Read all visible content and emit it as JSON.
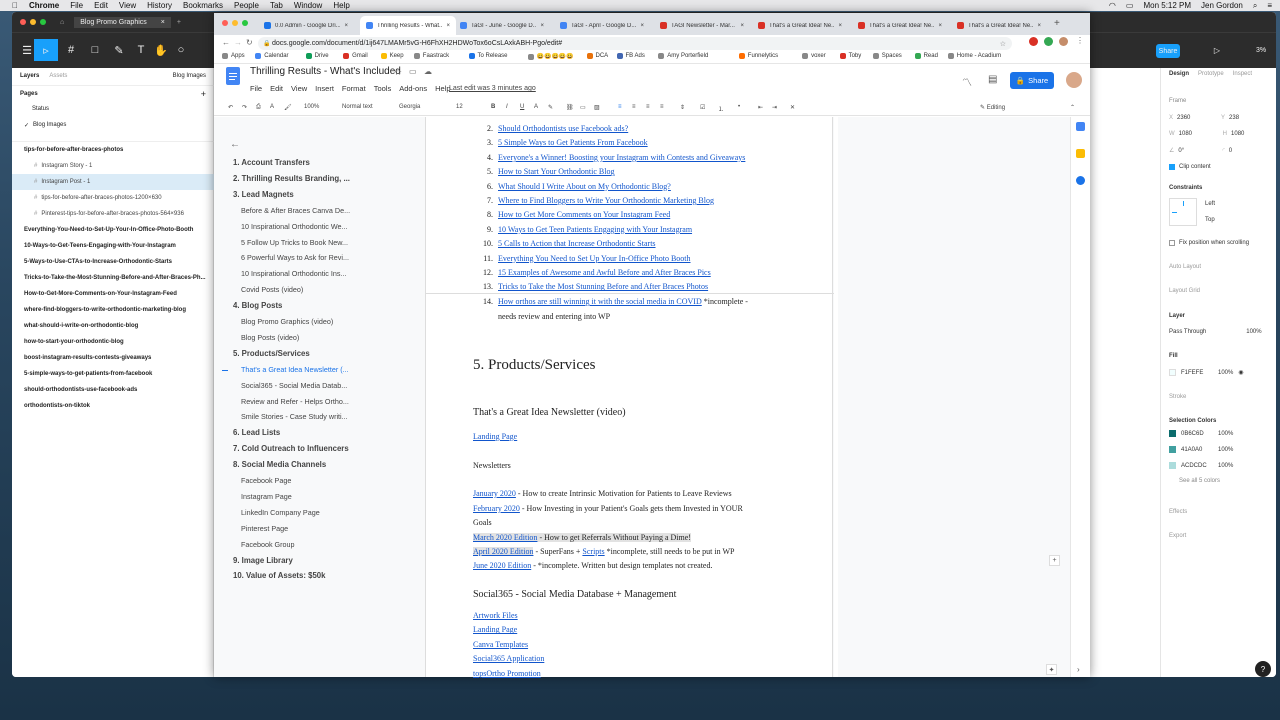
{
  "menubar": {
    "app": "Chrome",
    "items": [
      "File",
      "Edit",
      "View",
      "History",
      "Bookmarks",
      "People",
      "Tab",
      "Window",
      "Help"
    ],
    "clock": "Mon 5:12 PM",
    "user": "Jen Gordon"
  },
  "figma": {
    "file_tab": "Blog Promo Graphics",
    "left_tabs": {
      "layers": "Layers",
      "assets": "Assets",
      "page_select": "Blog Images"
    },
    "pages_title": "Pages",
    "pages": [
      "Status",
      "Blog Images"
    ],
    "layers": [
      {
        "label": "tips-for-before-after-braces-photos",
        "indent": 0,
        "bold": true
      },
      {
        "label": "Instagram Story - 1",
        "indent": 1,
        "bold": false
      },
      {
        "label": "Instagram Post - 1",
        "indent": 1,
        "bold": false,
        "selected": true
      },
      {
        "label": "tips-for-before-after-braces-photos-1200×630",
        "indent": 1,
        "bold": false
      },
      {
        "label": "Pinterest-tips-for-before-after-braces-photos-564×936",
        "indent": 1,
        "bold": false
      },
      {
        "label": "Everything-You-Need-to-Set-Up-Your-In-Office-Photo-Booth",
        "indent": 0,
        "bold": true
      },
      {
        "label": "10-Ways-to-Get-Teens-Engaging-with-Your-Instagram",
        "indent": 0,
        "bold": true
      },
      {
        "label": "5-Ways-to-Use-CTAs-to-Increase-Orthodontic-Starts",
        "indent": 0,
        "bold": true
      },
      {
        "label": "Tricks-to-Take-the-Most-Stunning-Before-and-After-Braces-Ph...",
        "indent": 0,
        "bold": true
      },
      {
        "label": "How-to-Get-More-Comments-on-Your-Instagram-Feed",
        "indent": 0,
        "bold": true
      },
      {
        "label": "where-find-bloggers-to-write-orthodontic-marketing-blog",
        "indent": 0,
        "bold": true
      },
      {
        "label": "what-should-i-write-on-orthodontic-blog",
        "indent": 0,
        "bold": true
      },
      {
        "label": "how-to-start-your-orthodontic-blog",
        "indent": 0,
        "bold": true
      },
      {
        "label": "boost-instagram-results-contests-giveaways",
        "indent": 0,
        "bold": true
      },
      {
        "label": "5-simple-ways-to-get-patients-from-facebook",
        "indent": 0,
        "bold": true
      },
      {
        "label": "should-orthodontists-use-facebook-ads",
        "indent": 0,
        "bold": true
      },
      {
        "label": "orthodontists-on-tiktok",
        "indent": 0,
        "bold": true
      }
    ],
    "right": {
      "tabs": [
        "Design",
        "Prototype",
        "Inspect"
      ],
      "frame_label": "Frame",
      "x": "2360",
      "y": "238",
      "w": "1080",
      "h": "1080",
      "rot": "0°",
      "radius": "0",
      "clip": "Clip content",
      "constraints": "Constraints",
      "c_h": "Left",
      "c_v": "Top",
      "fix": "Fix position when scrolling",
      "auto_layout": "Auto Layout",
      "layout_grid": "Layout Grid",
      "layer": "Layer",
      "blend": "Pass Through",
      "layer_opacity": "100%",
      "fill": "Fill",
      "fill_hex": "F1FEFE",
      "fill_opacity": "100%",
      "stroke": "Stroke",
      "sel_colors": "Selection Colors",
      "colors": [
        {
          "hex": "0B6C6D",
          "op": "100%",
          "swatch": "#0b6c6d"
        },
        {
          "hex": "41A0A0",
          "op": "100%",
          "swatch": "#41a0a0"
        },
        {
          "hex": "ACDCDC",
          "op": "100%",
          "swatch": "#acdcdc"
        }
      ],
      "see_all": "See all 5 colors",
      "effects": "Effects",
      "export": "Export"
    }
  },
  "chrome": {
    "tabs": [
      {
        "label": "0.0 Admin - Google Dri...",
        "color": "#1a73e8"
      },
      {
        "label": "Thrilling Results - What...",
        "color": "#4285f4",
        "active": true
      },
      {
        "label": "TaGI - June - Google D...",
        "color": "#4285f4"
      },
      {
        "label": "TaGI - April - Google D...",
        "color": "#4285f4"
      },
      {
        "label": "TAGI Newsletter - Mar...",
        "color": "#d93025"
      },
      {
        "label": "That's a Great Idea! Ne...",
        "color": "#d93025"
      },
      {
        "label": "That's a Great Idea! Ne...",
        "color": "#d93025"
      },
      {
        "label": "That's a Great Idea! Ne...",
        "color": "#d93025"
      }
    ],
    "url": "docs.google.com/document/d/1ij647LMAMr5vG-H6FhXH2HDWoTox6oCsLAxkABH-Pgo/edit#",
    "bookmarks": [
      "Apps",
      "Calendar",
      "Drive",
      "Gmail",
      "Keep",
      "Faastrack",
      "To Release",
      "😀😀😀😀😀",
      "DCA",
      "FB Ads",
      "Amy Porterfield",
      "Funnelytics",
      "voxer",
      "Toby",
      "Spaces",
      "Read",
      "Home - Acadium"
    ]
  },
  "docs": {
    "title": "Thrilling Results - What's Included",
    "menus": [
      "File",
      "Edit",
      "View",
      "Insert",
      "Format",
      "Tools",
      "Add-ons",
      "Help"
    ],
    "last_edit": "Last edit was 3 minutes ago",
    "share": "Share",
    "toolbar": {
      "zoom": "100%",
      "style": "Normal text",
      "font": "Georgia",
      "size": "12",
      "mode": "Editing"
    },
    "outline": [
      {
        "label": "1. Account Transfers",
        "lvl": 1
      },
      {
        "label": "2. Thrilling Results Branding, ...",
        "lvl": 1
      },
      {
        "label": "3. Lead Magnets",
        "lvl": 1
      },
      {
        "label": "Before & After Braces Canva De...",
        "lvl": 2
      },
      {
        "label": "10 Inspirational Orthodontic We...",
        "lvl": 2
      },
      {
        "label": "5 Follow Up Tricks to Book New...",
        "lvl": 2
      },
      {
        "label": "6 Powerful Ways to Ask for Revi...",
        "lvl": 2
      },
      {
        "label": "10 Inspirational Orthodontic Ins...",
        "lvl": 2
      },
      {
        "label": "Covid Posts (video)",
        "lvl": 2
      },
      {
        "label": "4. Blog Posts",
        "lvl": 1
      },
      {
        "label": "Blog Promo Graphics (video)",
        "lvl": 2
      },
      {
        "label": "Blog Posts (video)",
        "lvl": 2
      },
      {
        "label": "5. Products/Services",
        "lvl": 1
      },
      {
        "label": "That's a Great Idea Newsletter (...",
        "lvl": 2,
        "active": true
      },
      {
        "label": "Social365 - Social Media Datab...",
        "lvl": 2
      },
      {
        "label": "Review and Refer - Helps Ortho...",
        "lvl": 2
      },
      {
        "label": "Smile Stories - Case Study writi...",
        "lvl": 2
      },
      {
        "label": "6. Lead Lists",
        "lvl": 1
      },
      {
        "label": "7. Cold Outreach to Influencers",
        "lvl": 1
      },
      {
        "label": "8. Social Media Channels",
        "lvl": 1
      },
      {
        "label": "Facebook Page",
        "lvl": 2
      },
      {
        "label": "Instagram Page",
        "lvl": 2
      },
      {
        "label": "LinkedIn Company Page",
        "lvl": 2
      },
      {
        "label": "Pinterest Page",
        "lvl": 2
      },
      {
        "label": "Facebook Group",
        "lvl": 2
      },
      {
        "label": "9. Image Library",
        "lvl": 1
      },
      {
        "label": "10. Value of Assets: $50k",
        "lvl": 1
      }
    ],
    "blog_list": [
      {
        "n": "2.",
        "t": "Should Orthodontists use Facebook ads?",
        "link": true
      },
      {
        "n": "3.",
        "t": "5 Simple Ways to Get Patients From Facebook",
        "link": true
      },
      {
        "n": "4.",
        "t": "Everyone's a Winner! Boosting your Instagram with Contests and Giveaways",
        "link": true
      },
      {
        "n": "5.",
        "t": "How to Start Your Orthodontic Blog",
        "link": true
      },
      {
        "n": "6.",
        "t": "What Should I Write About on My Orthodontic Blog?",
        "link": true
      },
      {
        "n": "7.",
        "t": "Where to Find Bloggers to Write Your Orthodontic Marketing Blog",
        "link": true
      },
      {
        "n": "8.",
        "t": "How to Get More Comments on Your Instagram Feed",
        "link": true
      },
      {
        "n": "9.",
        "t": "10 Ways to Get Teen Patients Engaging with Your Instagram",
        "link": true
      },
      {
        "n": "10.",
        "t": "5 Calls to Action that Increase Orthodontic Starts",
        "link": true
      },
      {
        "n": "11.",
        "t": "Everything You Need to Set Up Your In-Office Photo Booth",
        "link": true
      },
      {
        "n": "12.",
        "t": "15 Examples of Awesome and Awful Before and After Braces Pics",
        "link": true
      },
      {
        "n": "13.",
        "t": "Tricks to Take the Most Stunning Before and After Braces Photos",
        "link": true
      }
    ],
    "item14_link": "How orthos are still winning it with the social media in COVID",
    "item14_rest": " *incomplete -",
    "item14_line2": "needs review and entering into WP",
    "h_products": "5. Products/Services",
    "h_newsletter": "That's a Great Idea Newsletter (video)",
    "landing_page": "Landing Page",
    "newsletters": "Newsletters",
    "jan_link": "January 2020",
    "jan_rest": " - How to create Intrinsic Motivation for Patients to Leave Reviews",
    "feb_link": "February 2020",
    "feb_rest": " - How Investing in your Patient's Goals gets them Invested in YOUR",
    "feb_line2": "Goals",
    "mar_link": "March 2020 Edition",
    "mar_rest": " - How to get Referrals Without Paying a Dime!",
    "apr_link": "April 2020 Edition",
    "apr_mid": " - SuperFans + ",
    "apr_scripts": "Scripts",
    "apr_rest": " *incomplete, still needs to be put in WP",
    "jun_link": "June 2020 Edition",
    "jun_rest": " - *incomplete. Written but design templates not created.",
    "h_social": "Social365 - Social Media Database + Management",
    "social_links": [
      "Artwork Files",
      "Landing Page",
      "Canva Templates",
      "Social365 Application",
      "topsOrtho Promotion"
    ]
  }
}
